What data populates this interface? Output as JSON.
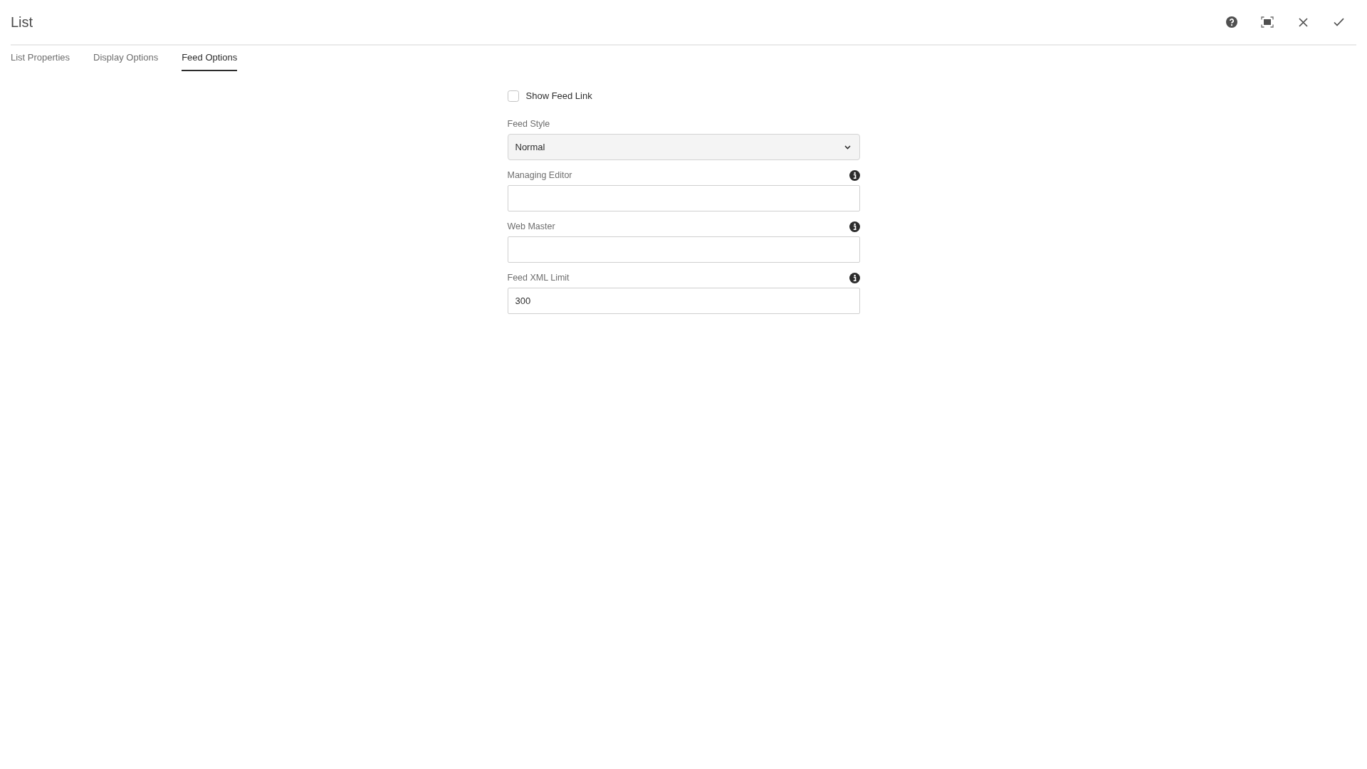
{
  "dialog": {
    "title": "List"
  },
  "tabs": [
    {
      "label": "List Properties",
      "selected": false
    },
    {
      "label": "Display Options",
      "selected": false
    },
    {
      "label": "Feed Options",
      "selected": true
    }
  ],
  "fields": [
    {
      "kind": "checkbox",
      "label": "Show Feed Link",
      "checked": false,
      "info": false
    },
    {
      "kind": "select",
      "label": "Feed Style",
      "value": "Normal",
      "info": false
    },
    {
      "kind": "text",
      "label": "Managing Editor",
      "info": true
    },
    {
      "kind": "text",
      "label": "Web Master",
      "info": true
    },
    {
      "kind": "text",
      "label": "Feed XML Limit",
      "value": "300",
      "info": true
    }
  ]
}
